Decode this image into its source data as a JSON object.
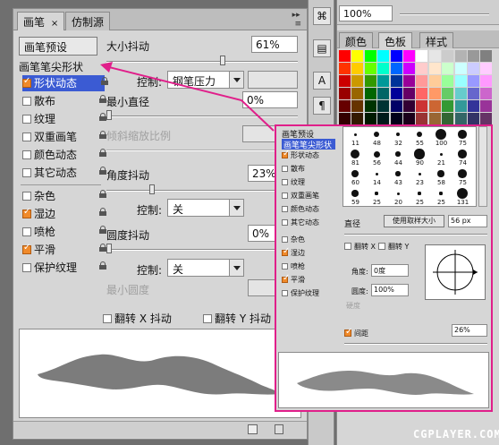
{
  "tabs": [
    {
      "label": "画笔",
      "close": "×"
    },
    {
      "label": "仿制源"
    }
  ],
  "preset_button": "画笔预设",
  "tip_shape_label": "画笔笔尖形状",
  "brush_options": [
    {
      "label": "形状动态",
      "checked": true,
      "lock": true,
      "selected": true
    },
    {
      "label": "散布",
      "checked": false,
      "lock": true
    },
    {
      "label": "纹理",
      "checked": false,
      "lock": true
    },
    {
      "label": "双重画笔",
      "checked": false,
      "lock": true
    },
    {
      "label": "颜色动态",
      "checked": false,
      "lock": true
    },
    {
      "label": "其它动态",
      "checked": false,
      "lock": true
    },
    {
      "label": "杂色",
      "checked": false,
      "lock": true
    },
    {
      "label": "湿边",
      "checked": true,
      "lock": true
    },
    {
      "label": "喷枪",
      "checked": false,
      "lock": true
    },
    {
      "label": "平滑",
      "checked": true,
      "lock": true
    },
    {
      "label": "保护纹理",
      "checked": false,
      "lock": true
    }
  ],
  "size_jitter": {
    "label": "大小抖动",
    "value": "61%",
    "slider": 0.61
  },
  "control1": {
    "label": "控制:",
    "value": "钢笔压力"
  },
  "min_diameter": {
    "label": "最小直径",
    "value": "0%",
    "slider": 0
  },
  "tilt_scale": {
    "label": "倾斜缩放比例"
  },
  "angle_jitter": {
    "label": "角度抖动",
    "value": "23%",
    "slider": 0.23
  },
  "control2": {
    "label": "控制:",
    "value": "关"
  },
  "roundness_jitter": {
    "label": "圆度抖动",
    "value": "0%",
    "slider": 0
  },
  "control3": {
    "label": "控制:",
    "value": "关"
  },
  "min_roundness": {
    "label": "最小圆度"
  },
  "flip_x": "翻转 X 抖动",
  "flip_y": "翻转 Y 抖动",
  "swatch_panel": {
    "zoom": "100%",
    "tabs": [
      "颜色",
      "色板",
      "样式"
    ],
    "colors": [
      "#ff0000",
      "#ffff00",
      "#00ff00",
      "#00ffff",
      "#0000ff",
      "#ff00ff",
      "#ffffff",
      "#e6e6e6",
      "#cccccc",
      "#b3b3b3",
      "#999999",
      "#808080",
      "#ff3300",
      "#ffcc00",
      "#66ff00",
      "#00ffcc",
      "#0066ff",
      "#cc00ff",
      "#ffcccc",
      "#ffe6cc",
      "#ccffcc",
      "#ccffff",
      "#ccccff",
      "#ffccff",
      "#cc0000",
      "#cc9900",
      "#339900",
      "#009999",
      "#003399",
      "#990099",
      "#ff9999",
      "#ffcc99",
      "#99ff99",
      "#99ffff",
      "#9999ff",
      "#ff99ff",
      "#990000",
      "#996600",
      "#006600",
      "#006666",
      "#000099",
      "#660066",
      "#ff6666",
      "#ff9966",
      "#66cc66",
      "#66cccc",
      "#6666cc",
      "#cc66cc",
      "#660000",
      "#663300",
      "#003300",
      "#003333",
      "#000066",
      "#330033",
      "#cc3333",
      "#cc6633",
      "#339933",
      "#339999",
      "#333399",
      "#993399",
      "#330000",
      "#331a00",
      "#001a00",
      "#001a1a",
      "#00001a",
      "#1a001a",
      "#993333",
      "#996633",
      "#336633",
      "#336666",
      "#333366",
      "#663366"
    ]
  },
  "inset": {
    "title": "画笔预设",
    "tip_label": "画笔笔尖形状",
    "options": [
      "形状动态",
      "散布",
      "纹理",
      "双重画笔",
      "颜色动态",
      "其它动态",
      "杂色",
      "湿边",
      "喷枪",
      "平滑",
      "保护纹理"
    ],
    "checked": [
      true,
      false,
      false,
      false,
      false,
      false,
      false,
      true,
      false,
      true,
      false
    ],
    "brush_sizes": [
      "11",
      "48",
      "32",
      "55",
      "100",
      "75",
      "81",
      "56",
      "44",
      "90",
      "21",
      "74",
      "60",
      "14",
      "43",
      "23",
      "58",
      "75",
      "59",
      "25",
      "20",
      "25",
      "25",
      "131"
    ],
    "diameter_label": "直径",
    "use_sample": "使用取样大小",
    "diameter_value": "56 px",
    "flip_x": "翻转 X",
    "flip_y": "翻转 Y",
    "angle_label": "角度:",
    "angle_value": "0度",
    "roundness_label": "圆度:",
    "roundness_value": "100%",
    "hardness_label": "硬度",
    "spacing_label": "间距",
    "spacing_value": "26%"
  },
  "watermark": "CGPLAYER.COM"
}
